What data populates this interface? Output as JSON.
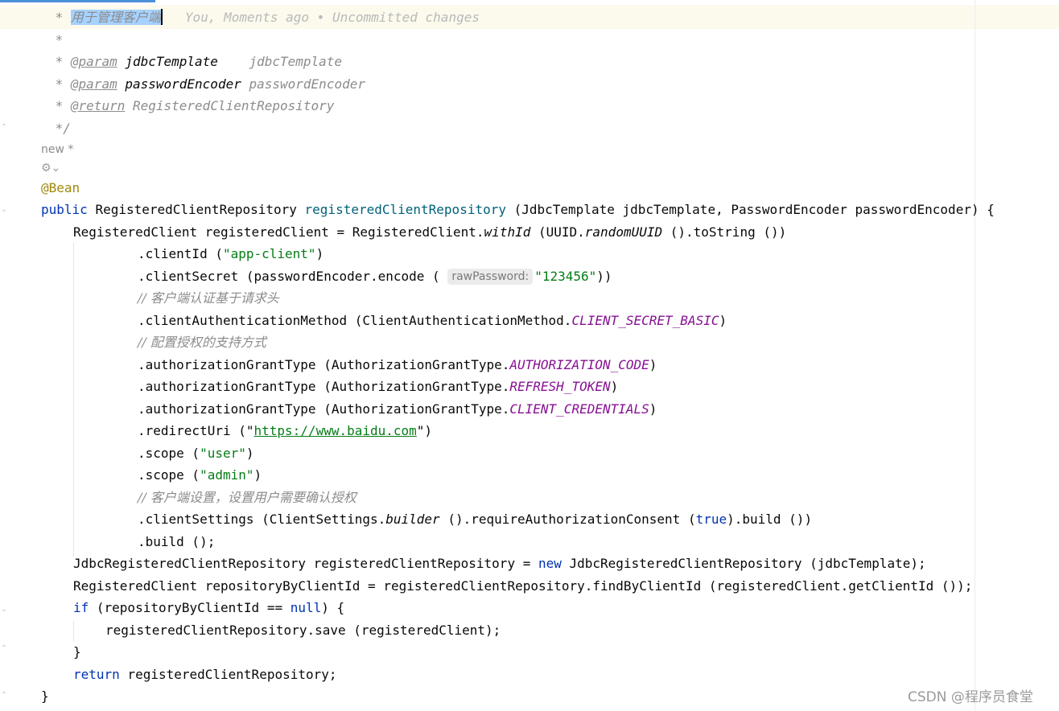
{
  "editor": {
    "doc_line1_prefix": " * ",
    "doc_line1_selected": "用于管理客户端",
    "blame": "You, Moments ago • Uncommitted changes",
    "doc_star": " *",
    "doc_param1_tag": "@param",
    "doc_param1_name": "jdbcTemplate",
    "doc_param1_desc": "jdbcTemplate",
    "doc_param2_tag": "@param",
    "doc_param2_name": "passwordEncoder",
    "doc_param2_desc": "passwordEncoder",
    "doc_return_tag": "@return",
    "doc_return_desc": "RegisteredClientRepository",
    "doc_end": " */",
    "lens_new": "new *",
    "lens_icon": "⚙⌄",
    "annotation": "@Bean",
    "kw_public": "public",
    "ret_type": "RegisteredClientRepository",
    "method_name": "registeredClientRepository",
    "method_params": " (JdbcTemplate jdbcTemplate, PasswordEncoder passwordEncoder) {",
    "l1_a": "RegisteredClient registeredClient = RegisteredClient.",
    "l1_withId": "withId",
    "l1_b": " (UUID.",
    "l1_randomUUID": "randomUUID",
    "l1_c": " ().toString ())",
    "clientId_pre": ".clientId (",
    "clientId_str": "\"app-client\"",
    "clientId_post": ")",
    "secret_pre": ".clientSecret (passwordEncoder.encode ( ",
    "secret_hint": "rawPassword:",
    "secret_str": "\"123456\"",
    "secret_post": "))",
    "comment1": "// 客户端认证基于请求头",
    "cam_pre": ".clientAuthenticationMethod (ClientAuthenticationMethod.",
    "cam_const": "CLIENT_SECRET_BASIC",
    "cam_post": ")",
    "comment2": "// 配置授权的支持方式",
    "agt_pre": ".authorizationGrantType (AuthorizationGrantType.",
    "agt1": "AUTHORIZATION_CODE",
    "agt2": "REFRESH_TOKEN",
    "agt3": "CLIENT_CREDENTIALS",
    "close_paren": ")",
    "redirect_pre": ".redirectUri (\"",
    "redirect_url": "https://www.baidu.com",
    "redirect_post": "\")",
    "scope_pre": ".scope (",
    "scope1": "\"user\"",
    "scope2": "\"admin\"",
    "comment3": "// 客户端设置，设置用户需要确认授权",
    "settings_pre": ".clientSettings (ClientSettings.",
    "settings_builder": "builder",
    "settings_mid": " ().requireAuthorizationConsent (",
    "kw_true": "true",
    "settings_post": ").build ())",
    "build_call": ".build ();",
    "repo_decl_a": "JdbcRegisteredClientRepository registeredClientRepository = ",
    "kw_new": "new",
    "repo_decl_b": " JdbcRegisteredClientRepository (jdbcTemplate);",
    "find_line": "RegisteredClient repositoryByClientId = registeredClientRepository.findByClientId (registeredClient.getClientId ());",
    "kw_if": "if",
    "if_a": " (repositoryByClientId == ",
    "kw_null": "null",
    "if_b": ") {",
    "save_line": "registeredClientRepository.save (registeredClient);",
    "close_brace": "}",
    "kw_return": "return",
    "return_rest": " registeredClientRepository;",
    "method_close": "}"
  },
  "watermark": "CSDN @程序员食堂"
}
